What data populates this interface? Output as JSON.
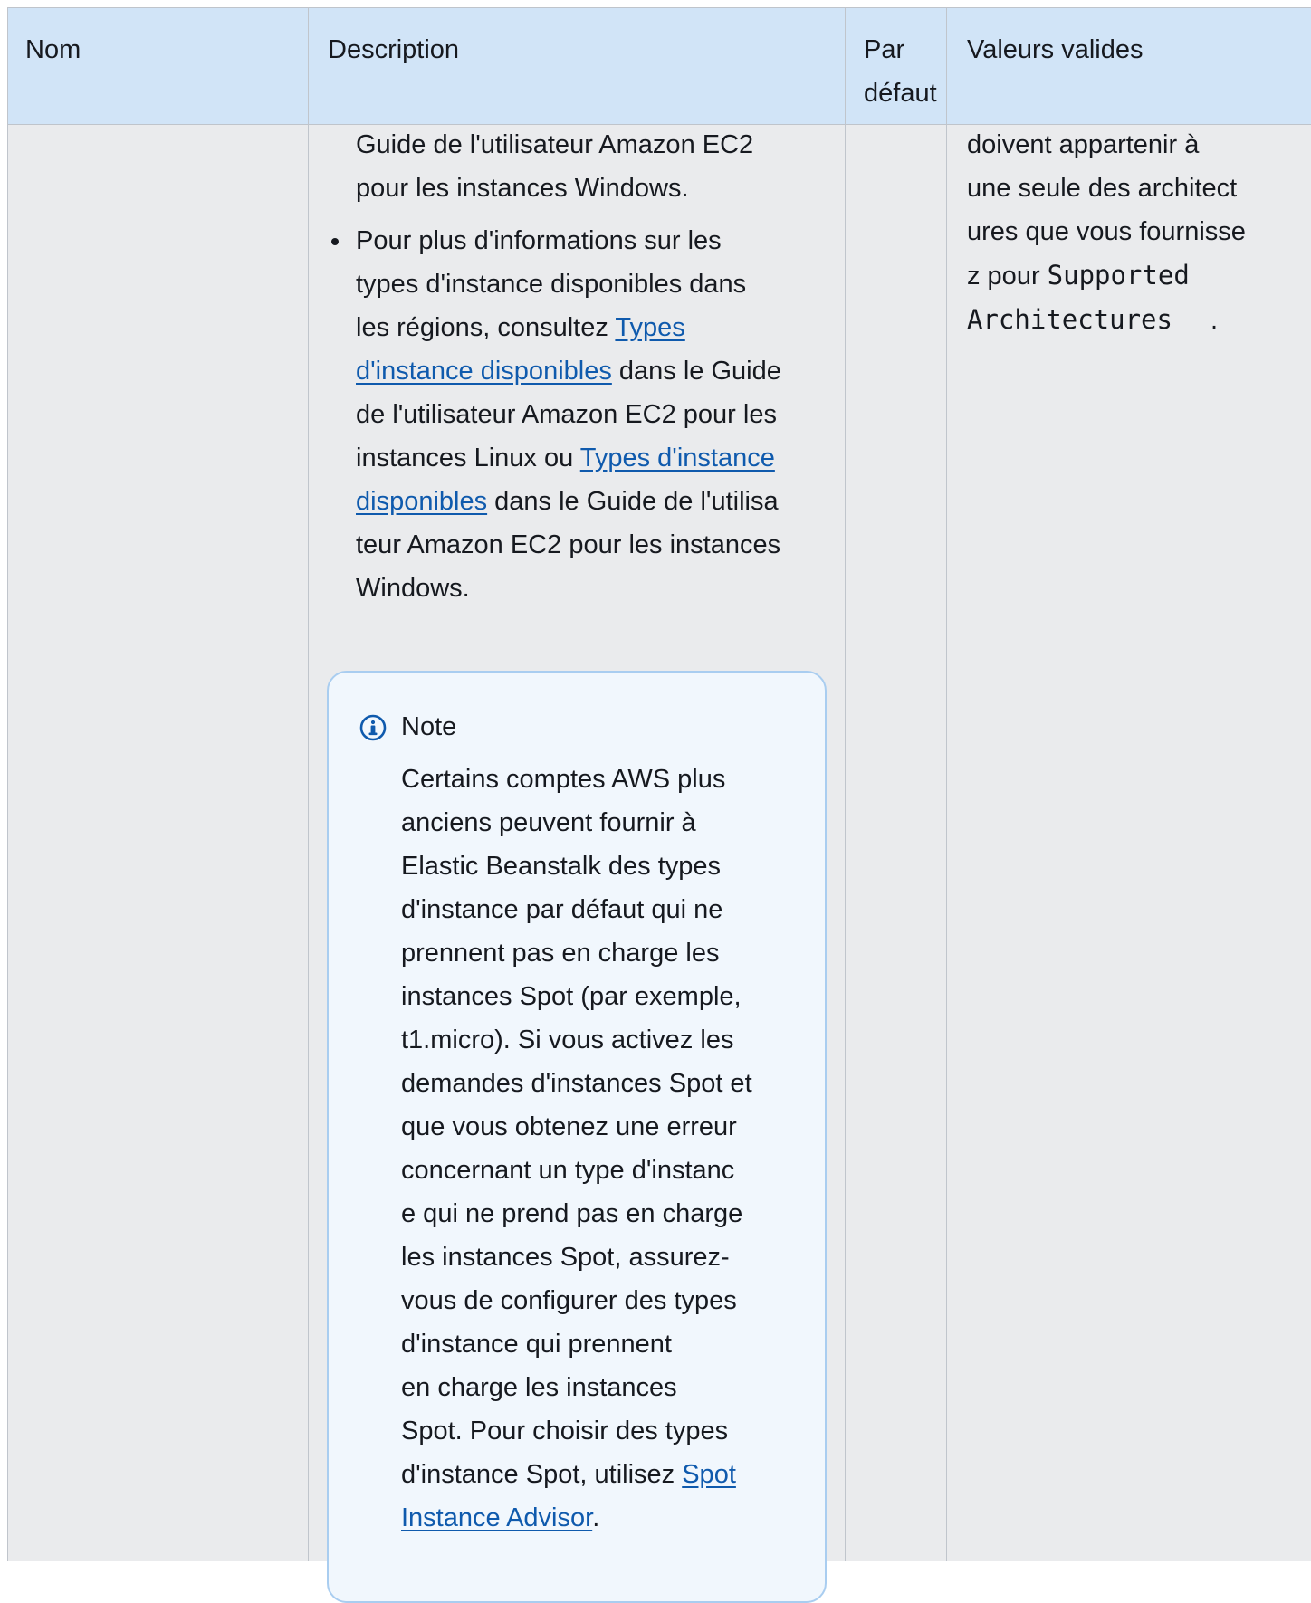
{
  "header": {
    "col_nom": "Nom",
    "col_description": "Description",
    "col_default_line1": "Par",
    "col_default_line2": "défaut",
    "col_valid_values": "Valeurs valides"
  },
  "description": {
    "para1_line1": "Guide de l'utilisateur Amazon EC2",
    "para1_line2": "pour les instances Windows.",
    "bullet_line1": "Pour plus d'informations sur les",
    "bullet_line2": "types d'instance disponibles dans",
    "bullet_line3_text": "les régions, consultez ",
    "bullet_line3_link": "Types",
    "bullet_line4_link": "d'instance disponibles",
    "bullet_line4_text": " dans le Guide",
    "bullet_line5": "de l'utilisateur Amazon EC2 pour les",
    "bullet_line6_text": "instances Linux ou ",
    "bullet_line6_link": "Types d'instance",
    "bullet_line7_link": "disponibles",
    "bullet_line7_text": " dans le Guide de l'utilisa",
    "bullet_line8": "teur Amazon EC2 pour les instances",
    "bullet_line9": "Windows."
  },
  "note": {
    "icon": "info-icon",
    "title": "Note",
    "lines": [
      "Certains comptes AWS plus",
      "anciens peuvent fournir à",
      "Elastic Beanstalk des types",
      "d'instance par défaut qui ne",
      "prennent pas en charge les",
      "instances Spot (par exemple,",
      "t1.micro). Si vous activez les",
      "demandes d'instances Spot et",
      "que vous obtenez une erreur",
      "concernant un type d'instanc",
      "e qui ne prend pas en charge",
      "les instances Spot, assurez-",
      "vous de configurer des types",
      "d'instance qui prennent",
      "en charge les instances",
      "Spot. Pour choisir des types"
    ],
    "last_line_text": "d'instance Spot, utilisez ",
    "last_line_link": "Spot",
    "final_line_link": "Instance Advisor",
    "final_line_text": "."
  },
  "valid_values": {
    "line1": "doivent appartenir à",
    "line2": "une seule des architect",
    "line3": "ures que vous fournisse",
    "line4_text": "z pour ",
    "line4_code": "Supported",
    "line5_code": "Architectures",
    "line5_text": "."
  },
  "colors": {
    "header_bg": "#d1e4f7",
    "body_bg": "#eaebed",
    "link": "#0f5aad",
    "note_bg": "#f1f7fd",
    "note_border": "#a9cdf0"
  }
}
